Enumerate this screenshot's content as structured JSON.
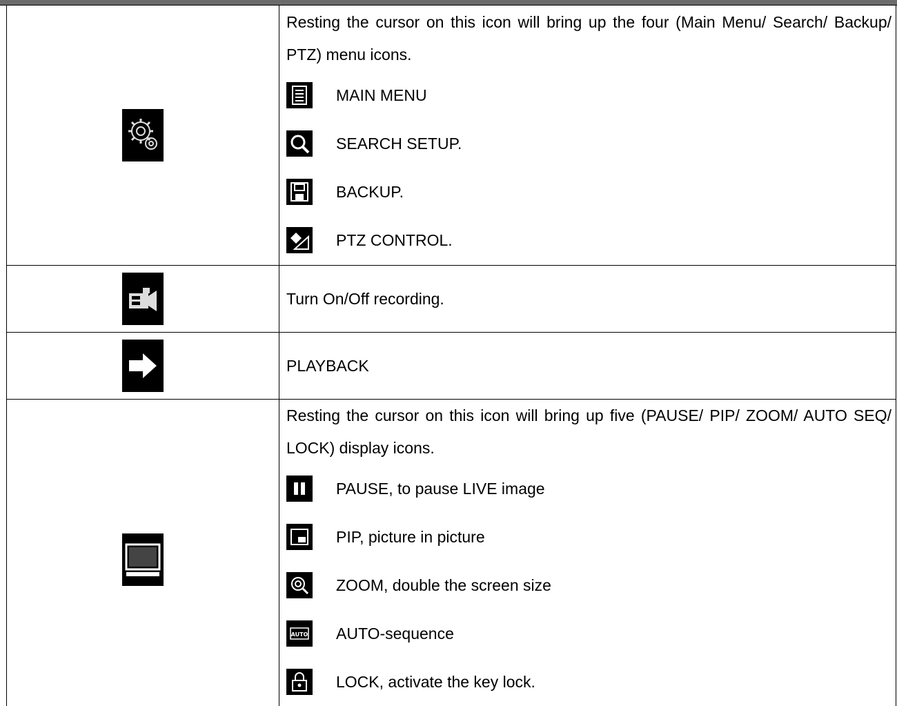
{
  "rows": [
    {
      "icon": "gear-icon",
      "intro": "Resting the cursor on this icon will bring up the four (Main Menu/ Search/ Backup/ PTZ) menu icons.",
      "items": [
        {
          "icon": "main-menu-icon",
          "label": "MAIN MENU"
        },
        {
          "icon": "search-icon",
          "label": "SEARCH SETUP."
        },
        {
          "icon": "floppy-disk-icon",
          "label": "BACKUP."
        },
        {
          "icon": "ptz-icon",
          "label": "PTZ CONTROL."
        }
      ]
    },
    {
      "icon": "camcorder-icon",
      "text": "Turn On/Off recording."
    },
    {
      "icon": "arrow-right-icon",
      "text": "PLAYBACK"
    },
    {
      "icon": "monitor-icon",
      "intro": "Resting the cursor on this icon will bring up five (PAUSE/ PIP/ ZOOM/ AUTO SEQ/ LOCK) display icons.",
      "items": [
        {
          "icon": "pause-icon",
          "label": "PAUSE, to pause LIVE image"
        },
        {
          "icon": "pip-icon",
          "label": "PIP, picture in picture"
        },
        {
          "icon": "zoom-icon",
          "label": "ZOOM, double the screen size"
        },
        {
          "icon": "auto-icon",
          "label": "AUTO-sequence",
          "glyph": "AUTO"
        },
        {
          "icon": "lock-icon",
          "label": "LOCK, activate the key lock."
        }
      ]
    }
  ]
}
